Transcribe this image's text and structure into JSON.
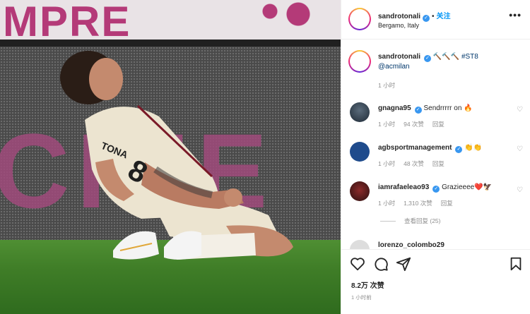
{
  "photo": {
    "alt_label": "sandrotonali post photo",
    "banner_text": "MPRE",
    "led_text": "CINE",
    "jersey_name": "TONA",
    "jersey_number": "8"
  },
  "header": {
    "username": "sandrotonali",
    "separator": "•",
    "follow_label": "关注",
    "location": "Bergamo, Italy",
    "more_icon": "more-horizontal-icon"
  },
  "caption": {
    "username": "sandrotonali",
    "text_emoji": "🔨🔨🔨",
    "hashtag": "#ST8",
    "mention": "@acmilan",
    "time": "1 小时"
  },
  "comments": [
    {
      "username": "gnagna95",
      "text": "Sendrrrrr on 🔥",
      "time": "1 小时",
      "likes": "94 次赞",
      "reply": "回复"
    },
    {
      "username": "agbsportmanagement",
      "text": "👏👏",
      "time": "1 小时",
      "likes": "48 次赞",
      "reply": "回复"
    },
    {
      "username": "iamrafaeleao93",
      "text": "Grazieeee❤️🦅",
      "time": "1 小时",
      "likes": "1,310 次赞",
      "reply": "回复"
    }
  ],
  "view_replies": "查看回复 (25)",
  "partial_comment_user": "lorenzo_colombo29",
  "actions": [
    "heart-icon",
    "comment-icon",
    "share-icon",
    "bookmark-icon"
  ],
  "stats": {
    "likes": "8.2万 次赞",
    "time": "1 小时前"
  },
  "colors": {
    "accent": "#0095f6",
    "verified": "#3897f0",
    "brand_pink": "#b43a78"
  }
}
